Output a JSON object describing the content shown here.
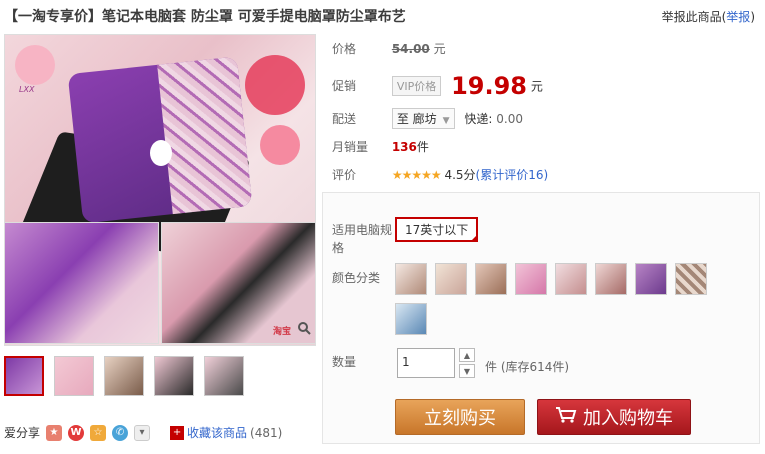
{
  "product": {
    "tag": "【一淘专享价】",
    "title": "笔记本电脑套 防尘罩 可爱手提电脑罩防尘罩布艺"
  },
  "report": {
    "text": "举报此商品",
    "link": "举报"
  },
  "gallery": {
    "logo_text": "LXX",
    "zoom_icon": "magnifier-icon",
    "watermark": "淘宝"
  },
  "price": {
    "label": "价格",
    "original": "54.00",
    "currency": "元"
  },
  "promo": {
    "label": "促销",
    "vip_tag": "VIP价格",
    "value": "19.98",
    "currency": "元"
  },
  "shipping": {
    "label": "配送",
    "destination": "至 廊坊",
    "express_label": "快递:",
    "express_fee": "0.00"
  },
  "sales": {
    "label": "月销量",
    "count": "136",
    "unit": "件"
  },
  "rating": {
    "label": "评价",
    "stars": "★★★★★",
    "score": "4.5分",
    "reviews": "(累计评价16)"
  },
  "sku": {
    "size_label": "适用电脑规格",
    "size_value": "17英寸以下",
    "color_label": "颜色分类",
    "qty_label": "数量",
    "qty_value": "1",
    "qty_unit": "件",
    "stock": "(库存614件)"
  },
  "actions": {
    "buy_label": "立刻购买",
    "cart_label": "加入购物车"
  },
  "share": {
    "label": "爱分享",
    "fav_label": "收藏该商品",
    "fav_count": "(481)"
  },
  "colors": {
    "price_red": "#c40000",
    "buy_orange": "#d88a3e",
    "cart_red": "#c0252b",
    "link_blue": "#3366cc"
  }
}
